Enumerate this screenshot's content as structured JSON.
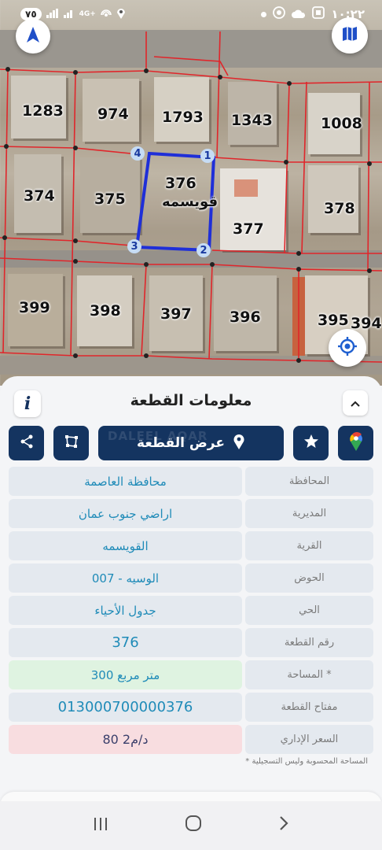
{
  "status_bar": {
    "battery": "٧٥",
    "network": "4G+",
    "time": "١٠:٢٢"
  },
  "map": {
    "plot_labels": [
      "1283",
      "974",
      "1793",
      "1343",
      "1008",
      "374",
      "375",
      "376",
      "قويسمه",
      "377",
      "378",
      "399",
      "398",
      "397",
      "396",
      "395",
      "394"
    ],
    "selected_plot_vertices": [
      "1",
      "2",
      "3",
      "4"
    ],
    "accent": "#1f2fd8",
    "parcel_line_color": "#e0262b"
  },
  "panel": {
    "title": "معلومات القطعة",
    "show_plot_label": "عرض القطعة",
    "watermark": "DALEEL AQAR"
  },
  "rows": [
    {
      "key": "المحافظة",
      "value": "محافظة العاصمة"
    },
    {
      "key": "المديرية",
      "value": "اراضي جنوب عمان"
    },
    {
      "key": "القرية",
      "value": "القويسمه"
    },
    {
      "key": "الحوض",
      "value": "الوسيه - 007"
    },
    {
      "key": "الحي",
      "value": "جدول الأحياء"
    },
    {
      "key": "رقم القطعة",
      "value": "376"
    },
    {
      "key": "المساحة *",
      "value": "300  متر مربع"
    },
    {
      "key": "مفتاح القطعة",
      "value": "013000700000376"
    },
    {
      "key": "السعر الإداري",
      "value": "80 د/م2"
    }
  ],
  "footnote": "* المساحة المحسوبة وليس التسجيلية"
}
